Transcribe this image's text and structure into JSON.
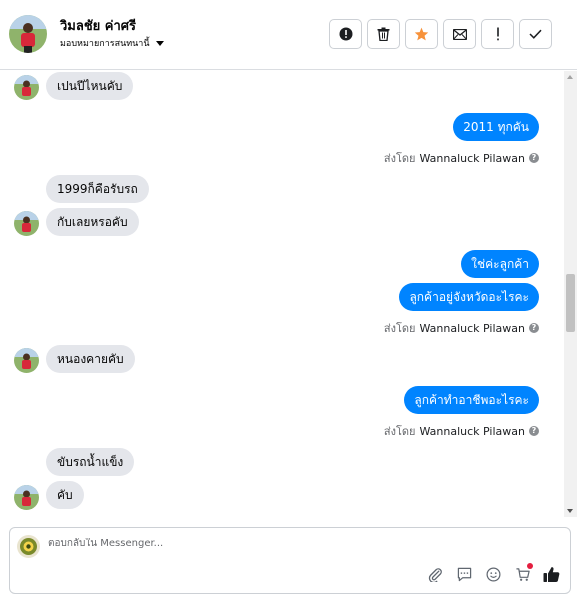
{
  "header": {
    "name": "วิมลชัย ค่าศรี",
    "assign_label": "มอบหมายการสนทนานี้",
    "tools": [
      {
        "icon": "alert-circle-icon",
        "name": "mark-spam-button"
      },
      {
        "icon": "trash-icon",
        "name": "delete-button"
      },
      {
        "icon": "star-icon",
        "name": "star-button"
      },
      {
        "icon": "envelope-icon",
        "name": "mark-unread-button"
      },
      {
        "icon": "exclamation-icon",
        "name": "follow-up-button"
      },
      {
        "icon": "check-icon",
        "name": "mark-done-button"
      }
    ],
    "star_color": "#f7923b"
  },
  "messages": {
    "m1": "เปนปีไหนคับ",
    "m2": "2011 ทุกคัน",
    "sent1_prefix": "ส่งโดย",
    "sent1_name": "Wannaluck Pilawan",
    "m3": "1999ก็คือรับรถ",
    "m4": "กับเลยหรอคับ",
    "m5": "ใช่ค่ะลูกค้า",
    "m6": "ลูกค้าอยู่จังหวัดอะไรคะ",
    "sent2_prefix": "ส่งโดย",
    "sent2_name": "Wannaluck Pilawan",
    "m7": "หนองคายคับ",
    "m8": "ลูกค้าทำอาชีพอะไรคะ",
    "sent3_prefix": "ส่งโดย",
    "sent3_name": "Wannaluck Pilawan",
    "m9": "ขับรถน้ำแข็ง",
    "m10": "คับ"
  },
  "composer": {
    "placeholder": "ตอบกลับใน Messenger...",
    "tools": [
      "paperclip-icon",
      "saved-reply-icon",
      "emoji-icon",
      "cart-icon",
      "thumbs-up-icon"
    ]
  },
  "colors": {
    "outgoing_bubble": "#0084ff",
    "incoming_bubble": "#e4e6eb"
  }
}
